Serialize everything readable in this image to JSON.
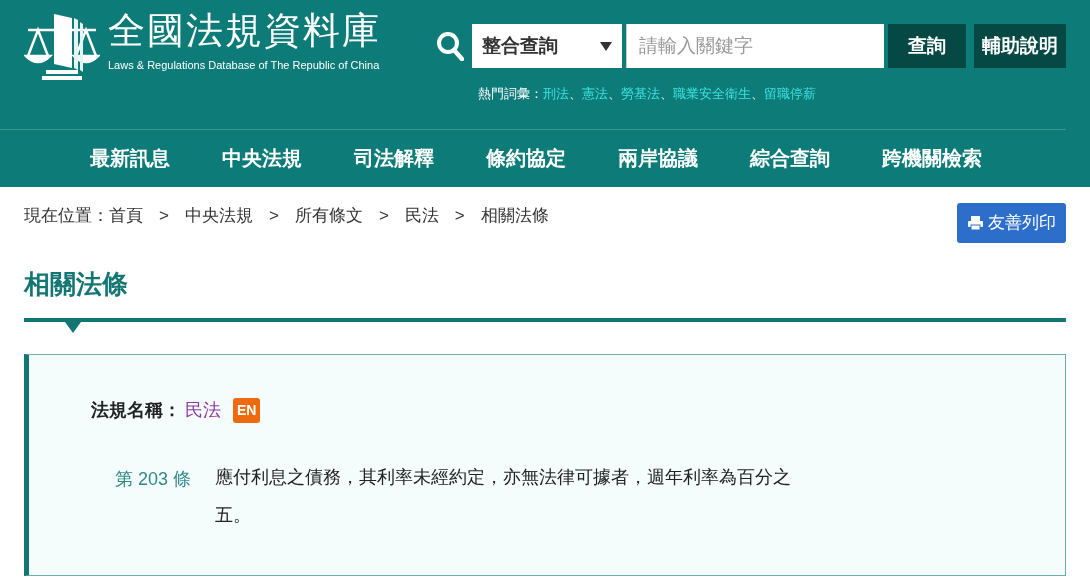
{
  "header": {
    "title": "全國法規資料庫",
    "subtitle": "Laws & Regulations Database of The Republic of China"
  },
  "search": {
    "scope": "整合查詢",
    "placeholder": "請輸入關鍵字",
    "buttons": [
      "查詢",
      "輔助說明"
    ],
    "hot_label": "熱門詞彙：",
    "hot_terms": [
      "刑法",
      "憲法",
      "勞基法",
      "職業安全衛生",
      "留職停薪"
    ],
    "separator": "、"
  },
  "nav": [
    "最新訊息",
    "中央法規",
    "司法解釋",
    "條約協定",
    "兩岸協議",
    "綜合查詢",
    "跨機關檢索"
  ],
  "breadcrumb": {
    "label": "現在位置：",
    "items": [
      "首頁",
      "中央法規",
      "所有條文",
      "民法",
      "相關法條"
    ],
    "separator": ">"
  },
  "print_button": "友善列印",
  "page_title": "相關法條",
  "law": {
    "label": "法規名稱：",
    "name": "民法",
    "badge": "EN"
  },
  "article": {
    "number": "第 203 條",
    "text": "應付利息之債務，其利率未經約定，亦無法律可據者，週年利率為百分之五。"
  }
}
